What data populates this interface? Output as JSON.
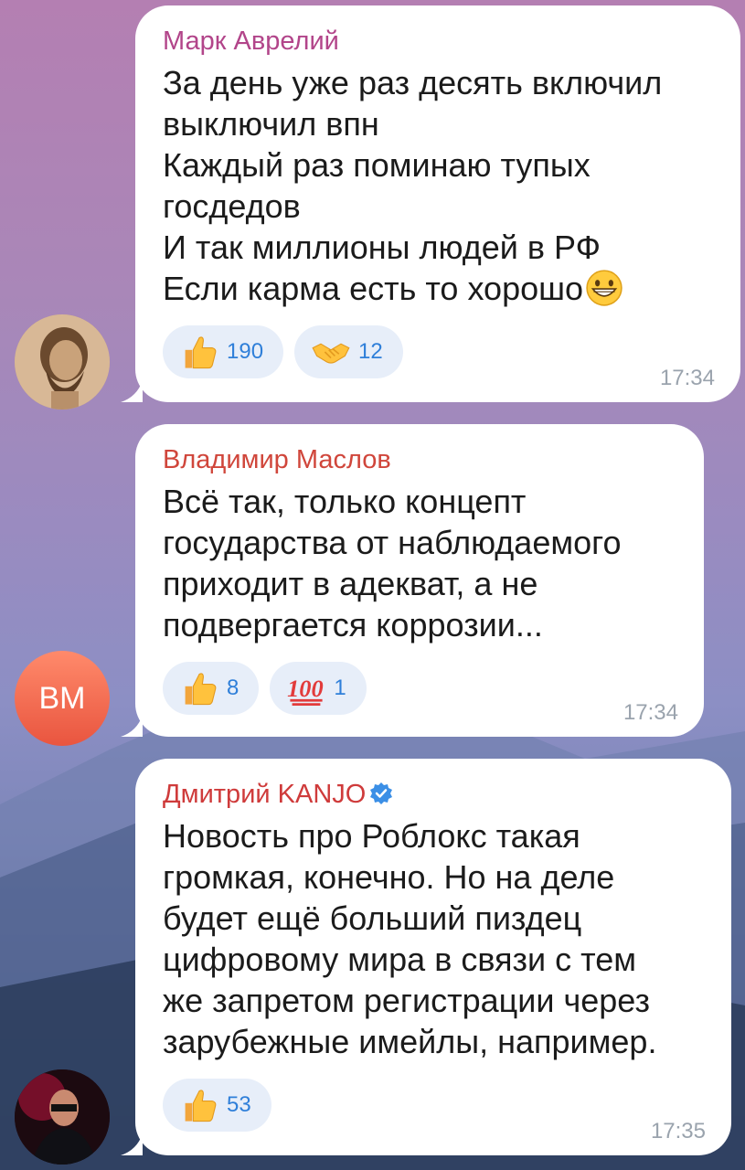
{
  "messages": [
    {
      "author": "Марк Аврелий",
      "text": "За день уже раз десять включил\nвыключил впн\nКаждый раз поминаю тупых\nгосдедов\nИ так миллионы людей в РФ\nЕсли карма есть то хорошо",
      "emoji_inline": "grinning-face-icon",
      "reactions": [
        {
          "icon": "thumbs-up-icon",
          "count": "190"
        },
        {
          "icon": "handshake-icon",
          "count": "12"
        }
      ],
      "time": "17:34",
      "avatar": "marcus-aurelius-bust"
    },
    {
      "author": "Владимир Маслов",
      "text": "Всё так, только концепт\nгосударства от наблюдаемого\nприходит в адекват, а не\nподвергается коррозии...",
      "reactions": [
        {
          "icon": "thumbs-up-icon",
          "count": "8"
        },
        {
          "icon": "hundred-points-icon",
          "count": "1"
        }
      ],
      "time": "17:34",
      "avatar_initials": "ВМ"
    },
    {
      "author": "Дмитрий KANJO",
      "verified": true,
      "text": "Новость про Роблокс такая\nгромкая, конечно. Но на деле\nбудет ещё больший пиздец\nцифровому мира в связи с тем\nже запретом регистрации через\nзарубежные имейлы, например.",
      "reactions": [
        {
          "icon": "thumbs-up-icon",
          "count": "53"
        }
      ],
      "time": "17:35",
      "avatar": "user-photo"
    }
  ],
  "colors": {
    "reaction_bg": "#e7eef9",
    "reaction_text": "#2f7fd9",
    "name_mark": "#b2458a",
    "name_vlad": "#d0463b",
    "name_dima": "#cf3b3b"
  }
}
